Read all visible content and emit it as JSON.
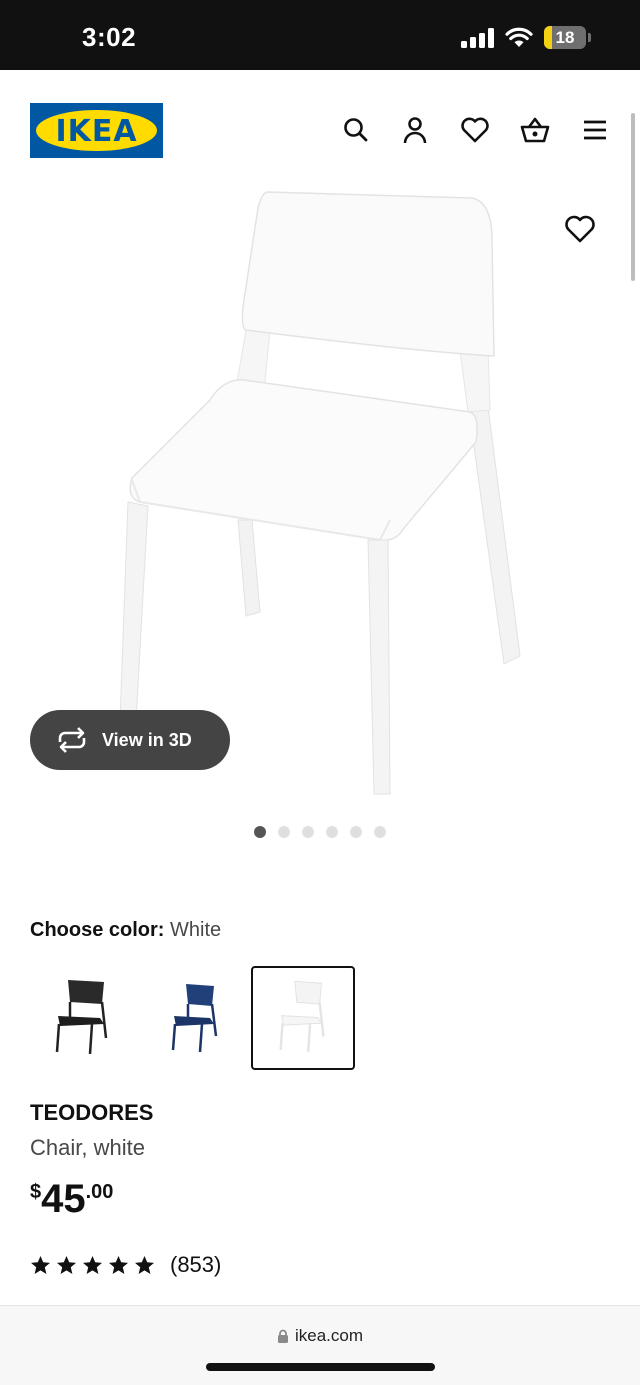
{
  "status_bar": {
    "time": "3:02",
    "battery": "18",
    "battery_level": 0.18
  },
  "header": {
    "logo_text": "IKEA"
  },
  "gallery": {
    "view_3d_label": "View in 3D",
    "page_count": 6,
    "active_page": 1
  },
  "color_chooser": {
    "label": "Choose color:",
    "value": "White",
    "options": [
      {
        "name": "black-chair",
        "color": "#222222",
        "selected": false
      },
      {
        "name": "blue-chair",
        "color": "#1f3f78",
        "selected": false
      },
      {
        "name": "white-chair",
        "color": "#f1f1f1",
        "selected": true
      }
    ]
  },
  "product": {
    "name": "TEODORES",
    "description": "Chair, white",
    "price": {
      "currency": "$",
      "integer": "45",
      "decimal": ".00"
    },
    "rating": {
      "stars": 5,
      "count": "(853)"
    }
  },
  "browser": {
    "url": "ikea.com"
  },
  "icons": [
    "search-icon",
    "account-icon",
    "favourites-icon",
    "cart-icon",
    "menu-icon",
    "heart-icon",
    "rotate-3d-icon",
    "lock-icon",
    "star-icon"
  ]
}
